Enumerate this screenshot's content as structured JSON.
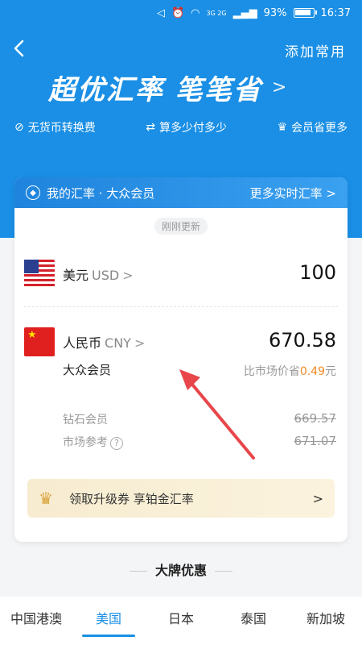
{
  "status": {
    "battery": "93%",
    "time": "16:37",
    "network": "3G 2G"
  },
  "nav": {
    "back": "<",
    "add_label": "添加常用"
  },
  "headline": {
    "text": "超优汇率 笔笔省",
    "chevron": ">"
  },
  "features": [
    {
      "icon": "no-fee-icon",
      "label": "无货币转换费"
    },
    {
      "icon": "calculate-icon",
      "label": "算多少付多少"
    },
    {
      "icon": "crown-icon",
      "label": "会员省更多"
    }
  ],
  "card": {
    "header_left": "我的汇率 · 大众会员",
    "header_right": "更多实时汇率 >",
    "updated": "刚刚更新",
    "from": {
      "name": "美元",
      "code": "USD",
      "amount": "100"
    },
    "to": {
      "name": "人民币",
      "code": "CNY",
      "amount": "670.58"
    },
    "member_label": "大众会员",
    "save_prefix": "比市场价省",
    "save_value": "0.49",
    "save_unit": "元",
    "diamond": {
      "label": "钻石会员",
      "value": "669.57"
    },
    "market": {
      "label": "市场参考",
      "value": "671.07"
    },
    "upgrade_label": "领取升级券 享铂金汇率"
  },
  "section_title": "大牌优惠",
  "tabs": [
    {
      "label": "中国港澳",
      "active": false
    },
    {
      "label": "美国",
      "active": true
    },
    {
      "label": "日本",
      "active": false
    },
    {
      "label": "泰国",
      "active": false
    },
    {
      "label": "新加坡",
      "active": false
    }
  ],
  "colors": {
    "primary": "#1a8fe5",
    "save": "#f08a24",
    "arrow": "#e8464a"
  }
}
